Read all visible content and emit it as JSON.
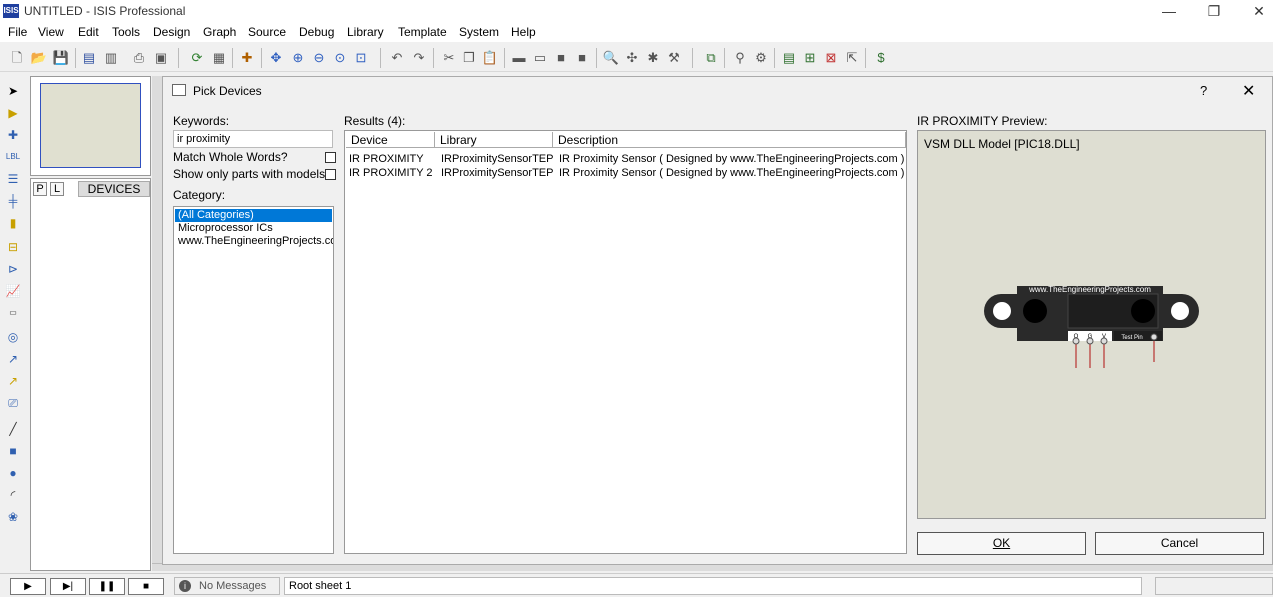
{
  "window": {
    "title": "UNTITLED - ISIS Professional",
    "icon_text": "ISIS"
  },
  "menu": [
    "File",
    "Edit",
    "View",
    "Tools",
    "Design",
    "Graph",
    "Source",
    "Debug",
    "Library",
    "Template",
    "System",
    "Help"
  ],
  "dialog": {
    "title": "Pick Devices",
    "help": "?",
    "close": "✕",
    "keywords_label": "Keywords:",
    "keywords_value": "ir proximity",
    "match_whole_words": "Match Whole Words?",
    "show_only_models": "Show only parts with models?",
    "category_label": "Category:",
    "categories": [
      "(All Categories)",
      "Microprocessor ICs",
      "www.TheEngineeringProjects.com"
    ],
    "results_label": "Results (4):",
    "columns": [
      "Device",
      "Library",
      "Description"
    ],
    "rows": [
      {
        "device": "IR PROXIMITY",
        "library": "IRProximitySensorTEP",
        "description": "IR Proximity Sensor ( Designed by www.TheEngineeringProjects.com )"
      },
      {
        "device": "IR PROXIMITY 2",
        "library": "IRProximitySensorTEP",
        "description": "IR Proximity Sensor ( Designed by www.TheEngineeringProjects.com )"
      }
    ],
    "preview_label": "IR PROXIMITY Preview:",
    "preview_model": "VSM DLL Model [PIC18.DLL]",
    "sensor": {
      "brand": "www.TheEngineeringProjects.com",
      "pins": [
        "O",
        "G",
        "V"
      ],
      "test_pin": "Test Pin"
    },
    "ok": "OK",
    "cancel": "Cancel"
  },
  "selector": {
    "p": "P",
    "l": "L",
    "devices": "DEVICES"
  },
  "status": {
    "messages": "No Messages",
    "sheet": "Root sheet 1"
  }
}
